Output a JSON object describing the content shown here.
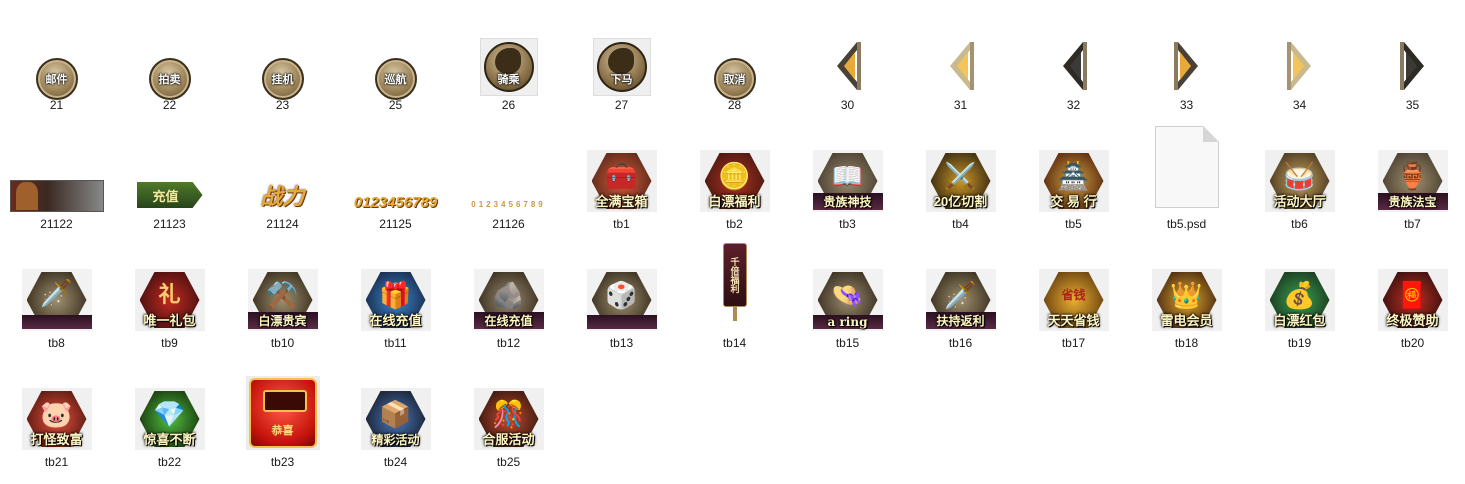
{
  "row1": [
    {
      "file": "21",
      "label": "邮件"
    },
    {
      "file": "22",
      "label": "拍卖"
    },
    {
      "file": "23",
      "label": "挂机"
    },
    {
      "file": "25",
      "label": "巡航"
    },
    {
      "file": "26",
      "label": "骑乘"
    },
    {
      "file": "27",
      "label": "下马"
    },
    {
      "file": "28",
      "label": "取消"
    },
    {
      "file": "30"
    },
    {
      "file": "31"
    },
    {
      "file": "32"
    },
    {
      "file": "33"
    },
    {
      "file": "34"
    },
    {
      "file": "35"
    }
  ],
  "row2": [
    {
      "file": "21122"
    },
    {
      "file": "21123",
      "label": "充值"
    },
    {
      "file": "21124",
      "label": "战力"
    },
    {
      "file": "21125",
      "label": "0123456789"
    },
    {
      "file": "21126",
      "label": "0123456789"
    },
    {
      "file": "tb1",
      "label": "全满宝箱"
    },
    {
      "file": "tb2",
      "label": "白漂福利"
    },
    {
      "file": "tb3",
      "label": "贵族神技"
    },
    {
      "file": "tb4",
      "label": "20亿切割"
    },
    {
      "file": "tb5",
      "label": "交 易 行"
    },
    {
      "file": "tb5.psd"
    },
    {
      "file": "tb6",
      "label": "活动大厅"
    },
    {
      "file": "tb7",
      "label": "贵族法宝"
    }
  ],
  "row3": [
    {
      "file": "tb8"
    },
    {
      "file": "tb9",
      "label": "唯一礼包",
      "glyph": "礼"
    },
    {
      "file": "tb10",
      "label": "白漂贵宾"
    },
    {
      "file": "tb11",
      "label": "在线充值"
    },
    {
      "file": "tb12",
      "label": "在线充值"
    },
    {
      "file": "tb13"
    },
    {
      "file": "tb14",
      "label": "千倍福利"
    },
    {
      "file": "tb15",
      "label": "a ring"
    },
    {
      "file": "tb16",
      "label": "扶持返利"
    },
    {
      "file": "tb17",
      "label": "天天省钱",
      "glyph": "省钱"
    },
    {
      "file": "tb18",
      "label": "雷电会员"
    },
    {
      "file": "tb19",
      "label": "白漂红包"
    },
    {
      "file": "tb20",
      "label": "终极赞助"
    }
  ],
  "row4": [
    {
      "file": "tb21",
      "label": "打怪致富"
    },
    {
      "file": "tb22",
      "label": "惊喜不断"
    },
    {
      "file": "tb23",
      "label": "恭喜"
    },
    {
      "file": "tb24",
      "label": "精彩活动"
    },
    {
      "file": "tb25",
      "label": "合服活动"
    }
  ],
  "colors": {
    "bronze": "#9b8257",
    "hex_dark": "#4a4a4a",
    "label_gold": "#fff5c0",
    "red": "#c6140c",
    "background": "#ffffff"
  }
}
